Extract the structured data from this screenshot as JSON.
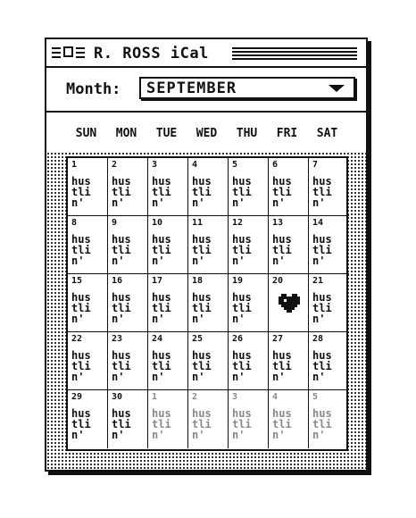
{
  "window": {
    "title": "R. ROSS iCal"
  },
  "month_selector": {
    "label": "Month:",
    "value": "SEPTEMBER"
  },
  "weekdays": [
    "SUN",
    "MON",
    "TUE",
    "WED",
    "THU",
    "FRI",
    "SAT"
  ],
  "calendar": {
    "cell_text": "hus\ntli\nn'",
    "weeks": [
      [
        {
          "day": "1",
          "text": "hus\ntli\nn'"
        },
        {
          "day": "2",
          "text": "hus\ntli\nn'"
        },
        {
          "day": "3",
          "text": "hus\ntli\nn'"
        },
        {
          "day": "4",
          "text": "hus\ntli\nn'"
        },
        {
          "day": "5",
          "text": "hus\ntli\nn'"
        },
        {
          "day": "6",
          "text": "hus\ntli\nn'"
        },
        {
          "day": "7",
          "text": "hus\ntli\nn'"
        }
      ],
      [
        {
          "day": "8",
          "text": "hus\ntli\nn'"
        },
        {
          "day": "9",
          "text": "hus\ntli\nn'"
        },
        {
          "day": "10",
          "text": "hus\ntli\nn'"
        },
        {
          "day": "11",
          "text": "hus\ntli\nn'"
        },
        {
          "day": "12",
          "text": "hus\ntli\nn'"
        },
        {
          "day": "13",
          "text": "hus\ntli\nn'"
        },
        {
          "day": "14",
          "text": "hus\ntli\nn'"
        }
      ],
      [
        {
          "day": "15",
          "text": "hus\ntli\nn'"
        },
        {
          "day": "16",
          "text": "hus\ntli\nn'"
        },
        {
          "day": "17",
          "text": "hus\ntli\nn'"
        },
        {
          "day": "18",
          "text": "hus\ntli\nn'"
        },
        {
          "day": "19",
          "text": "hus\ntli\nn'"
        },
        {
          "day": "20",
          "text": "",
          "icon": "heart-icon"
        },
        {
          "day": "21",
          "text": "hus\ntli\nn'"
        }
      ],
      [
        {
          "day": "22",
          "text": "hus\ntli\nn'"
        },
        {
          "day": "23",
          "text": "hus\ntli\nn'"
        },
        {
          "day": "24",
          "text": "hus\ntli\nn'"
        },
        {
          "day": "25",
          "text": "hus\ntli\nn'"
        },
        {
          "day": "26",
          "text": "hus\ntli\nn'"
        },
        {
          "day": "27",
          "text": "hus\ntli\nn'"
        },
        {
          "day": "28",
          "text": "hus\ntli\nn'"
        }
      ],
      [
        {
          "day": "29",
          "text": "hus\ntli\nn'"
        },
        {
          "day": "30",
          "text": "hus\ntli\nn'"
        },
        {
          "day": "1",
          "text": "hus\ntli\nn'",
          "other_month": true
        },
        {
          "day": "2",
          "text": "hus\ntli\nn'",
          "other_month": true
        },
        {
          "day": "3",
          "text": "hus\ntli\nn'",
          "other_month": true
        },
        {
          "day": "4",
          "text": "hus\ntli\nn'",
          "other_month": true
        },
        {
          "day": "5",
          "text": "hus\ntli\nn'",
          "other_month": true
        }
      ]
    ]
  },
  "icons": {
    "menu": "menu-lines-icon",
    "box": "window-box-icon",
    "dropdown": "chevron-down-icon",
    "heart": "heart-icon"
  },
  "colors": {
    "ink": "#111111",
    "other_month": "#8a8a8a",
    "background": "#ffffff"
  }
}
